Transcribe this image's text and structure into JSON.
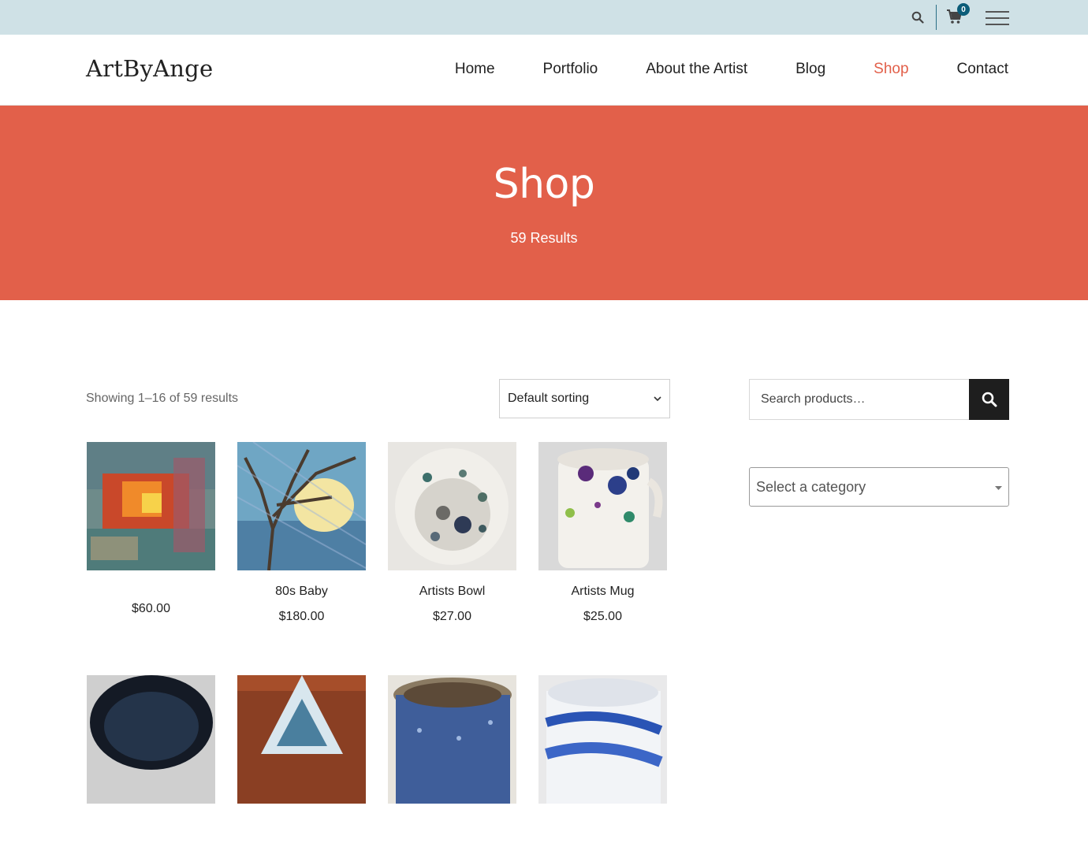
{
  "topbar": {
    "cart_count": "0",
    "accent": "#0b5c78",
    "bg": "#cfe1e6"
  },
  "header": {
    "logo": "ArtByAnge",
    "nav": [
      {
        "label": "Home",
        "active": false
      },
      {
        "label": "Portfolio",
        "active": false
      },
      {
        "label": "About the Artist",
        "active": false
      },
      {
        "label": "Blog",
        "active": false
      },
      {
        "label": "Shop",
        "active": true
      },
      {
        "label": "Contact",
        "active": false
      }
    ],
    "active_color": "#e2604a"
  },
  "hero": {
    "title": "Shop",
    "results": "59 Results",
    "bg": "#e2604a"
  },
  "toolbar": {
    "result_count": "Showing 1–16 of 59 results",
    "sort_value": "Default sorting"
  },
  "sidebar": {
    "search_placeholder": "Search products…",
    "category_value": "Select a category"
  },
  "products": [
    {
      "title": "",
      "price": "$60.00",
      "image": "abstract-red-painting"
    },
    {
      "title": "80s Baby",
      "price": "$180.00",
      "image": "tree-moon-painting"
    },
    {
      "title": "Artists Bowl",
      "price": "$27.00",
      "image": "speckled-bowl"
    },
    {
      "title": "Artists Mug",
      "price": "$25.00",
      "image": "splatter-mug"
    },
    {
      "title": "",
      "price": "",
      "image": "dark-blue-bowl"
    },
    {
      "title": "",
      "price": "",
      "image": "mountain-triangle-art"
    },
    {
      "title": "",
      "price": "",
      "image": "blue-speckled-pot"
    },
    {
      "title": "",
      "price": "",
      "image": "blue-white-swirl-pot"
    }
  ]
}
